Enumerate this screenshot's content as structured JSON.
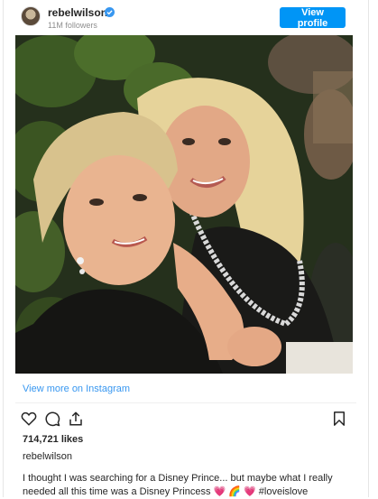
{
  "header": {
    "username": "rebelwilson",
    "followers": "11M followers",
    "view_profile_label": "View profile"
  },
  "footer": {
    "view_more_label": "View more on Instagram",
    "likes": "714,721 likes",
    "caption_username": "rebelwilson",
    "caption_text": "I thought I was searching for a Disney Prince... but maybe what I really needed all this time was a Disney Princess 💗 🌈 💗 #loveislove"
  },
  "colors": {
    "accent": "#0095f6",
    "link": "#3897f0",
    "muted": "#8e8e8e"
  },
  "icons": {
    "like": "heart-icon",
    "comment": "comment-icon",
    "share": "share-icon",
    "save": "bookmark-icon",
    "verified": "verified-badge-icon"
  }
}
